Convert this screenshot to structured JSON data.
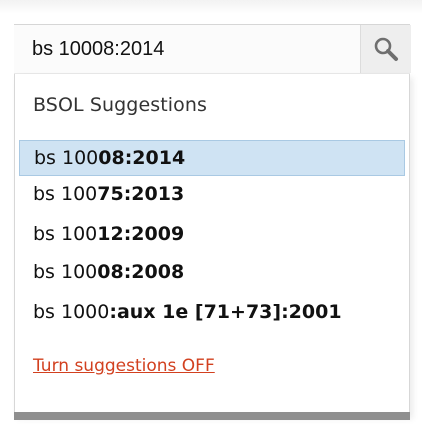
{
  "search": {
    "value": "bs 10008:2014",
    "button_icon": "search-icon"
  },
  "dropdown": {
    "heading": "BSOL Suggestions",
    "suggestions": [
      {
        "typed": "bs 100",
        "match": "08:2014",
        "active": true
      },
      {
        "typed": "bs 100",
        "match": "75:2013",
        "active": false
      },
      {
        "typed": "bs 100",
        "match": "12:2009",
        "active": false
      },
      {
        "typed": "bs 100",
        "match": "08:2008",
        "active": false
      },
      {
        "typed": "bs 1000",
        "match": ":aux 1e [71+73]:2001",
        "active": false
      }
    ],
    "turn_off_label": "Turn suggestions OFF"
  },
  "colors": {
    "highlight_bg": "#cfe3f3",
    "highlight_border": "#a9c9e3",
    "link": "#d2401f",
    "text": "#111111"
  }
}
